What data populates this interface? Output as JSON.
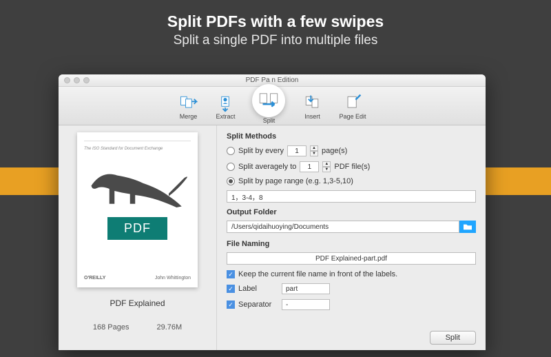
{
  "promo": {
    "headline": "Split PDFs with a few swipes",
    "subheadline": "Split a single PDF into multiple files"
  },
  "window": {
    "title": "PDF Pa            n Edition",
    "toolbar": {
      "merge": "Merge",
      "extract": "Extract",
      "split": "Split",
      "insert": "Insert",
      "page_edit": "Page Edit"
    }
  },
  "preview": {
    "topbar": "                     ",
    "subtitle": "The ISO Standard for Document Exchange",
    "badge": "PDF",
    "publisher": "O'REILLY",
    "author": "John Whittington",
    "filename": "PDF Explained",
    "pages": "168 Pages",
    "size": "29.76M"
  },
  "split": {
    "methods_header": "Split Methods",
    "opt_every_pre": "Split by every",
    "opt_every_val": "1",
    "opt_every_post": "page(s)",
    "opt_avg_pre": "Split averagely to",
    "opt_avg_val": "1",
    "opt_avg_post": "PDF file(s)",
    "opt_range": "Split by page range (e.g. 1,3-5,10)",
    "range_value": "1，3-4，8",
    "output_header": "Output Folder",
    "output_path": "/Users/qidaihuoying/Documents",
    "naming_header": "File Naming",
    "naming_preview": "PDF Explained-part.pdf",
    "keep_name": "Keep the current file name in front of the labels.",
    "label_text": "Label",
    "label_value": "part",
    "separator_text": "Separator",
    "separator_value": "-",
    "split_button": "Split"
  }
}
